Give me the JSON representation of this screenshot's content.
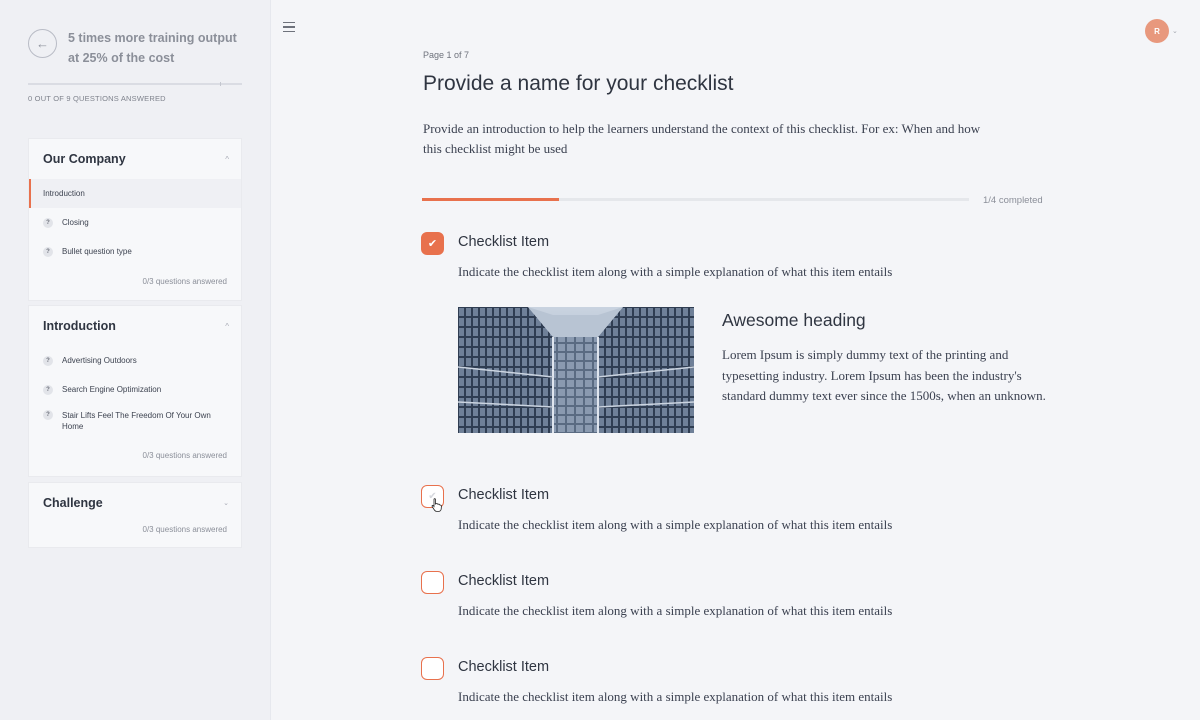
{
  "sidebar": {
    "course_title": "5 times more training output at 25% of the cost",
    "answered_count": "0 OUT OF 9 QUESTIONS ANSWERED",
    "sections": [
      {
        "title": "Our Company",
        "expanded": true,
        "lessons": [
          {
            "label": "Introduction",
            "active": true
          },
          {
            "label": "Closing",
            "badge": "?"
          },
          {
            "label": "Bullet question type",
            "badge": "?"
          }
        ],
        "footer": "0/3 questions answered"
      },
      {
        "title": "Introduction",
        "expanded": true,
        "lessons": [
          {
            "label": "Advertising Outdoors",
            "badge": "?"
          },
          {
            "label": "Search Engine Optimization",
            "badge": "?"
          },
          {
            "label": "Stair Lifts Feel The Freedom Of Your Own Home",
            "badge": "?"
          }
        ],
        "footer": "0/3 questions answered"
      },
      {
        "title": "Challenge",
        "expanded": false,
        "lessons": [],
        "footer": "0/3 questions answered"
      }
    ]
  },
  "header": {
    "avatar_initial": "R",
    "icons": {
      "menu": "hamburger-menu-icon",
      "back": "arrow-left-icon",
      "avatar_caret": "chevron-down-icon"
    }
  },
  "main": {
    "page_label": "Page 1 of 7",
    "title": "Provide a name for your checklist",
    "intro": "Provide an introduction to help the learners understand the context of this checklist. For ex: When and how this checklist might be used",
    "progress": {
      "fraction": 0.25,
      "label": "1/4 completed"
    },
    "items": [
      {
        "title": "Checklist Item",
        "description": "Indicate the checklist item along with a simple explanation of what this item entails",
        "checked": true
      },
      {
        "title": "Checklist Item",
        "description": "Indicate the checklist item along with a simple explanation of what this item entails",
        "checked": false,
        "hovered": true
      },
      {
        "title": "Checklist Item",
        "description": "Indicate the checklist item along with a simple explanation of what this item entails",
        "checked": false
      },
      {
        "title": "Checklist Item",
        "description": "Indicate the checklist item along with a simple explanation of what this item entails",
        "checked": false
      }
    ],
    "media": {
      "heading": "Awesome heading",
      "text": "Lorem Ipsum is simply dummy text of the printing and typesetting industry. Lorem Ipsum has been the industry's standard dummy text ever since the 1500s, when an unknown."
    }
  },
  "colors": {
    "accent": "#e8714d",
    "avatar": "#e8987d",
    "text": "#2f3541",
    "muted": "#8b8f99",
    "background": "#f4f5f8",
    "sidebar": "#eff0f4"
  }
}
